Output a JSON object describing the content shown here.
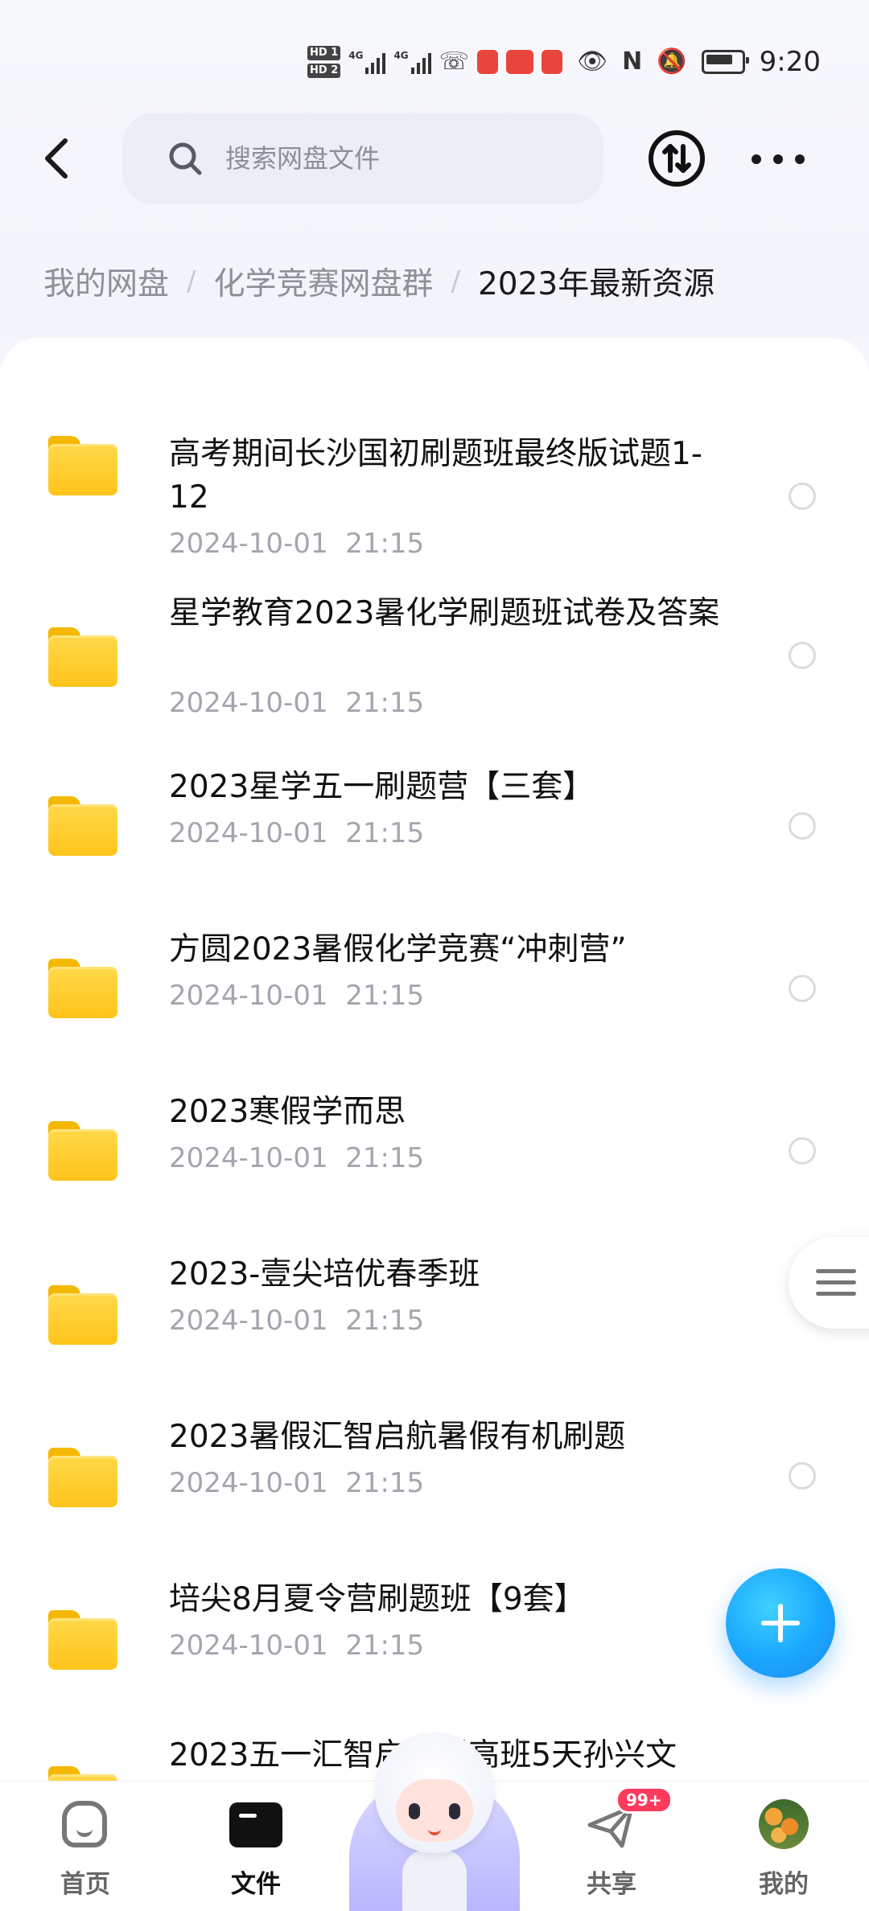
{
  "status_bar": {
    "hd1": "HD 1",
    "hd2": "HD 2",
    "sim1": "4G",
    "sim2": "4G",
    "time": "9:20",
    "icons": [
      "eye-icon",
      "nfc-icon",
      "mute-icon",
      "battery-icon"
    ]
  },
  "header": {
    "back_icon": "chevron-left-icon",
    "search_placeholder": "搜索网盘文件",
    "search_value": "",
    "transfer_icon": "transfer-icon",
    "more_icon": "more-horizontal-icon"
  },
  "breadcrumb": {
    "items": [
      "我的网盘",
      "化学竞赛网盘群",
      "2023年最新资源"
    ],
    "separator": "/"
  },
  "files": [
    {
      "name": "高考期间长沙国初刷题班最终版试题1-12",
      "date": "2024-10-01  21:15"
    },
    {
      "name": "星学教育2023暑化学刷题班试卷及答案",
      "date": "2024-10-01  21:15"
    },
    {
      "name": "2023星学五一刷题营【三套】",
      "date": "2024-10-01  21:15"
    },
    {
      "name": "方圆2023暑假化学竞赛“冲刺营”",
      "date": "2024-10-01  21:15"
    },
    {
      "name": "2023寒假学而思",
      "date": "2024-10-01  21:15"
    },
    {
      "name": "2023-壹尖培优春季班",
      "date": "2024-10-01  21:15"
    },
    {
      "name": "2023暑假汇智启航暑假有机刷题",
      "date": "2024-10-01  21:15"
    },
    {
      "name": "培尖8月夏令营刷题班【9套】",
      "date": "2024-10-01  21:15"
    },
    {
      "name": "2023五一汇智启航提高班5天孙兴文",
      "date": ""
    }
  ],
  "fab": {
    "icon": "plus-icon"
  },
  "bottom_nav": {
    "items": [
      {
        "label": "首页",
        "icon": "home-icon",
        "active": false
      },
      {
        "label": "文件",
        "icon": "folder-icon",
        "active": true
      },
      {
        "label": "共享",
        "icon": "paper-plane-icon",
        "active": false,
        "badge": "99+"
      },
      {
        "label": "我的",
        "icon": "avatar-icon",
        "active": false
      }
    ]
  },
  "colors": {
    "accent": "#1aa6ff",
    "folder": "#ffc41a",
    "badge": "#ff3b5c"
  }
}
